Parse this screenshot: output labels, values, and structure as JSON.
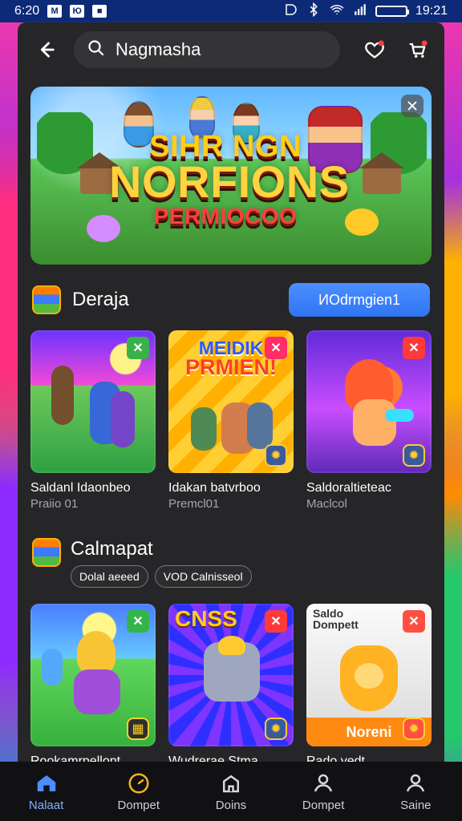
{
  "status": {
    "time_left": "6:20",
    "badge_1": "M",
    "badge_2": "Ю",
    "badge_3": "■",
    "time_right": "19:21"
  },
  "header": {
    "search_text": "Nagmasha"
  },
  "hero": {
    "line_1": "SIHR NGN",
    "line_2": "NORFIONS",
    "line_3": "PERMIOCOO"
  },
  "section_1": {
    "title": "Deraja",
    "button_label": "ИОdrmgien1"
  },
  "row_1": [
    {
      "name": "Saldanl Idaonbeo",
      "meta": "Praiio 01"
    },
    {
      "name": "Idakan batvrboo",
      "meta": "Premcl01",
      "art_top": "MEIDIK",
      "art_bottom": "PRMIEN!"
    },
    {
      "name": "Saldoraltieteac",
      "meta": "Maclcol"
    }
  ],
  "section_2": {
    "title": "Calmapat",
    "tags": [
      "Dolal aeeed",
      "VOD Calnisseol"
    ]
  },
  "row_2": [
    {
      "name": "Rookamrpellont",
      "meta": ""
    },
    {
      "name": "Wudrerae Stma",
      "meta": "",
      "art_title": "CNSS"
    },
    {
      "name": "Rado yedt",
      "meta": "",
      "art_title_1": "Saldo",
      "art_title_2": "Dompett",
      "banner": "Noreni"
    }
  ],
  "nav": [
    {
      "label": "Nalaat"
    },
    {
      "label": "Dompet"
    },
    {
      "label": "Doins"
    },
    {
      "label": "Dompet"
    },
    {
      "label": "Saine"
    }
  ],
  "colors": {
    "accent": "#2f74f3",
    "active_nav": "#7fb3ff",
    "brand_yellow": "#ffcf2d"
  }
}
